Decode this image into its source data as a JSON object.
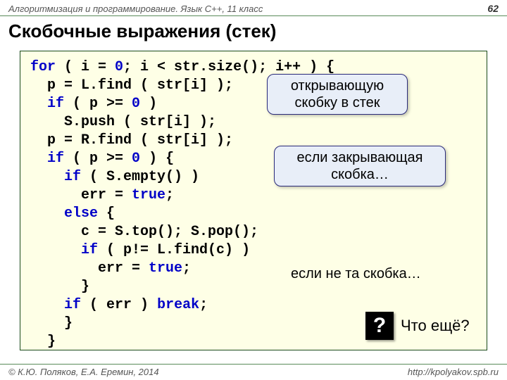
{
  "header": {
    "subject": "Алгоритмизация и программирование. Язык C++, 11 класс",
    "page_number": "62"
  },
  "title": "Скобочные выражения (стек)",
  "code": {
    "l01_a": "for",
    "l01_b": " ( i = ",
    "l01_c": "0",
    "l01_d": "; i < str.size(); i++ ) {",
    "l02": "  p = L.find ( str[i] );",
    "l03_a": "  ",
    "l03_b": "if",
    "l03_c": " ( p >= ",
    "l03_d": "0",
    "l03_e": " )",
    "l04": "    S.push ( str[i] );",
    "l05": "  p = R.find ( str[i] );",
    "l06_a": "  ",
    "l06_b": "if",
    "l06_c": " ( p >= ",
    "l06_d": "0",
    "l06_e": " ) {",
    "l07_a": "    ",
    "l07_b": "if",
    "l07_c": " ( S.empty() )",
    "l08_a": "      err = ",
    "l08_b": "true",
    "l08_c": ";",
    "l09_a": "    ",
    "l09_b": "else",
    "l09_c": " {",
    "l10": "      c = S.top(); S.pop();",
    "l11_a": "      ",
    "l11_b": "if",
    "l11_c": " ( p!= L.find(c) )",
    "l12_a": "        err = ",
    "l12_b": "true",
    "l12_c": ";",
    "l13": "      }",
    "l14_a": "    ",
    "l14_b": "if",
    "l14_c": " ( err ) ",
    "l14_d": "break",
    "l14_e": ";",
    "l15": "    }",
    "l16": "  }"
  },
  "callouts": {
    "c1_line1": "открывающую",
    "c1_line2": "скобку в стек",
    "c2_line1": "если закрывающая",
    "c2_line2": "скобка…",
    "c3": "если не та скобка…"
  },
  "question": {
    "mark": "?",
    "text": "Что ещё?"
  },
  "footer": {
    "authors": "© К.Ю. Поляков, Е.А. Еремин, 2014",
    "url": "http://kpolyakov.spb.ru"
  }
}
